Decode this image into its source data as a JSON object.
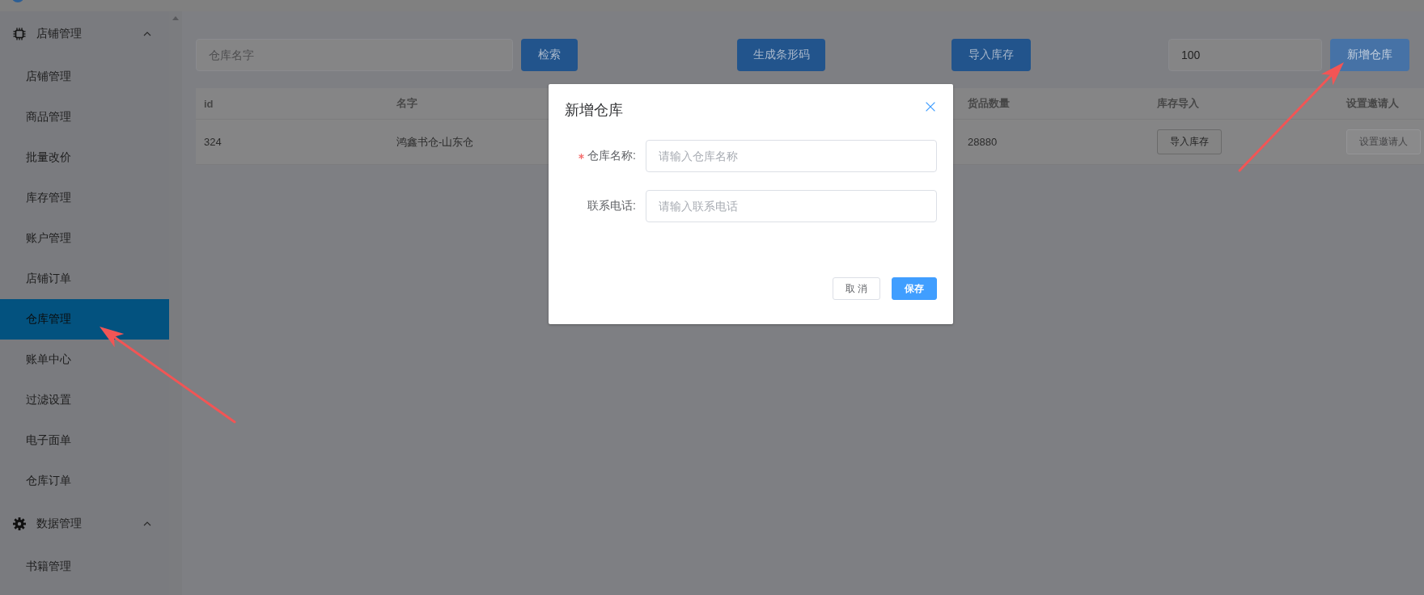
{
  "sidebar": {
    "groups": [
      {
        "label": "店铺管理",
        "expanded": true,
        "items": [
          {
            "label": "店铺管理",
            "selected": false
          },
          {
            "label": "商品管理",
            "selected": false
          },
          {
            "label": "批量改价",
            "selected": false
          },
          {
            "label": "库存管理",
            "selected": false
          },
          {
            "label": "账户管理",
            "selected": false
          },
          {
            "label": "店铺订单",
            "selected": false
          },
          {
            "label": "仓库管理",
            "selected": true
          },
          {
            "label": "账单中心",
            "selected": false
          },
          {
            "label": "过滤设置",
            "selected": false
          },
          {
            "label": "电子面单",
            "selected": false
          },
          {
            "label": "仓库订单",
            "selected": false
          }
        ]
      },
      {
        "label": "数据管理",
        "expanded": true,
        "items": [
          {
            "label": "书籍管理",
            "selected": false
          }
        ]
      }
    ]
  },
  "toolbar": {
    "items": [
      {
        "kind": "field",
        "placeholder": "仓库名字"
      },
      {
        "kind": "button",
        "label": "检索",
        "focused": false
      },
      {
        "kind": "button",
        "label": "生成条形码",
        "focused": false
      },
      {
        "kind": "button",
        "label": "导入库存",
        "focused": false
      },
      {
        "kind": "field",
        "value": "100"
      },
      {
        "kind": "button",
        "label": "新增仓库",
        "focused": true
      }
    ]
  },
  "table": {
    "columns": [
      "id",
      "名字",
      "货品数量",
      "库存导入",
      "设置邀请人"
    ],
    "rows": [
      {
        "cells": [
          {
            "kind": "text",
            "text": "324"
          },
          {
            "kind": "text",
            "text": "鸿鑫书仓-山东仓"
          },
          {
            "kind": "text",
            "text": "28880"
          },
          {
            "kind": "button",
            "text": "导入库存",
            "disabled": false
          },
          {
            "kind": "button",
            "text": "设置邀请人",
            "disabled": true
          }
        ]
      }
    ]
  },
  "dialog": {
    "title": "新增仓库",
    "fields": [
      {
        "label": "仓库名称:",
        "required": true,
        "placeholder": "请输入仓库名称"
      },
      {
        "label": "联系电话:",
        "required": false,
        "placeholder": "请输入联系电话"
      }
    ],
    "buttons": [
      {
        "label": "取 消",
        "kind": "default"
      },
      {
        "label": "保存",
        "kind": "primary"
      }
    ]
  }
}
